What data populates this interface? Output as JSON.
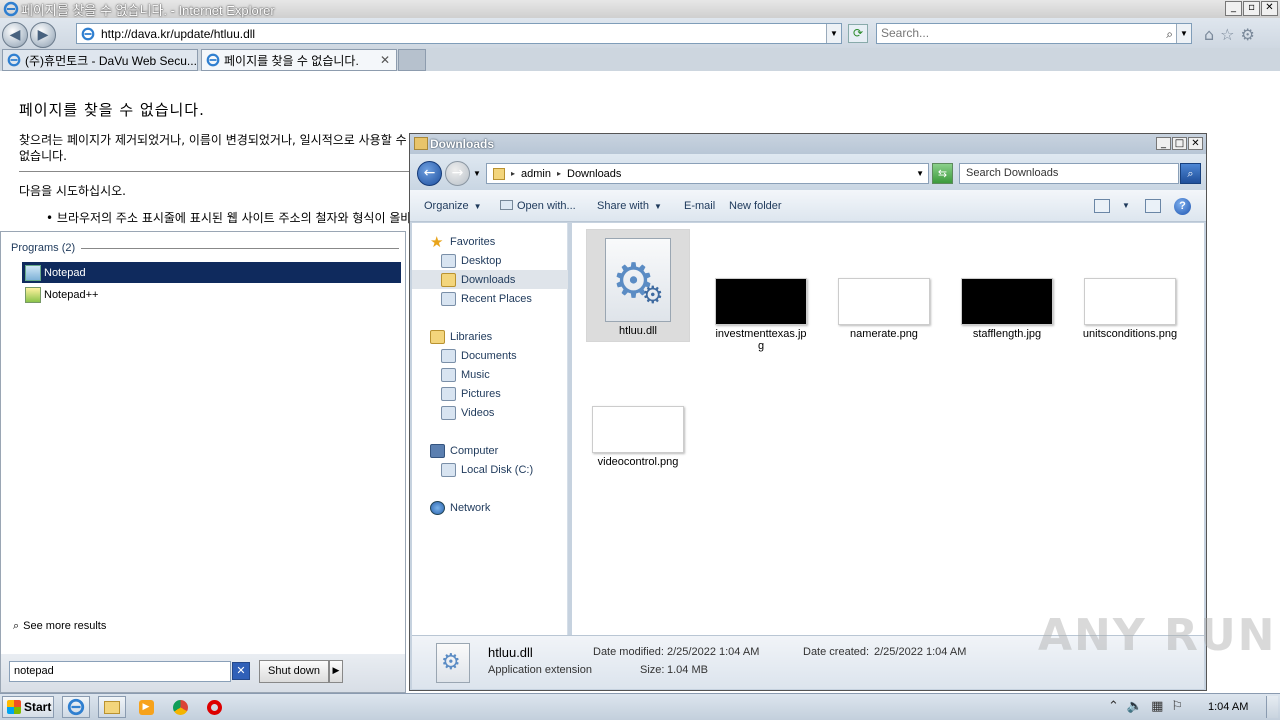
{
  "ie": {
    "title": "페이지를 찾을 수 없습니다. - Internet Explorer",
    "window_buttons": [
      "_",
      "▫",
      "✕"
    ],
    "address": "http://dava.kr/update/htluu.dll",
    "search_placeholder": "Search...",
    "tabs": [
      {
        "label": "(주)휴먼토크 - DaVu Web Secu...",
        "active": false
      },
      {
        "label": "페이지를 찾을 수 없습니다.",
        "active": true,
        "close": "✕"
      }
    ],
    "tool_icons": [
      "home-icon",
      "favorites-star-icon",
      "tools-gear-icon"
    ],
    "content": {
      "heading": "페이지를 찾을 수 없습니다.",
      "para1": "찾으려는 페이지가 제거되었거나, 이름이 변경되었거나, 일시적으로 사용할 수 없습니다.",
      "para2": "다음을 시도하십시오.",
      "bullet1": "브라우저의 주소 표시줄에 표시된 웹 사이트 주소의 철자와 형식이 올바른지 확인하십시오."
    }
  },
  "startmenu": {
    "programs_header": "Programs (2)",
    "programs": [
      {
        "label": "Notepad",
        "selected": true
      },
      {
        "label": "Notepad++",
        "selected": false
      }
    ],
    "see_more": "See more results",
    "search_value": "notepad",
    "clear_button": "✕",
    "shutdown_label": "Shut down",
    "shutdown_arrow": "▶"
  },
  "explorer": {
    "title": "Downloads",
    "breadcrumb": [
      "admin",
      "Downloads"
    ],
    "search_placeholder": "Search Downloads",
    "commands": {
      "organize": "Organize",
      "open_with": "Open with...",
      "share_with": "Share with",
      "email": "E-mail",
      "new_folder": "New folder"
    },
    "nav": {
      "favorites": "Favorites",
      "desktop": "Desktop",
      "downloads": "Downloads",
      "recent": "Recent Places",
      "libraries": "Libraries",
      "documents": "Documents",
      "music": "Music",
      "pictures": "Pictures",
      "videos": "Videos",
      "computer": "Computer",
      "local_disk": "Local Disk (C:)",
      "network": "Network"
    },
    "files": [
      {
        "name": "htluu.dll",
        "kind": "dll",
        "selected": true
      },
      {
        "name": "investmenttexas.jpg",
        "kind": "black"
      },
      {
        "name": "namerate.png",
        "kind": "white"
      },
      {
        "name": "stafflength.jpg",
        "kind": "black"
      },
      {
        "name": "unitsconditions.png",
        "kind": "white"
      },
      {
        "name": "videocontrol.png",
        "kind": "white"
      }
    ],
    "details": {
      "name": "htluu.dll",
      "type": "Application extension",
      "modified_label": "Date modified:",
      "modified": "2/25/2022 1:04 AM",
      "created_label": "Date created:",
      "created": "2/25/2022 1:04 AM",
      "size_label": "Size:",
      "size": "1.04 MB"
    }
  },
  "taskbar": {
    "start_label": "Start",
    "clock": "1:04 AM",
    "pinned": [
      "internet-explorer-icon",
      "explorer-folder-icon",
      "media-player-icon",
      "chrome-icon",
      "opera-icon"
    ]
  },
  "watermark": "ANY RUN"
}
